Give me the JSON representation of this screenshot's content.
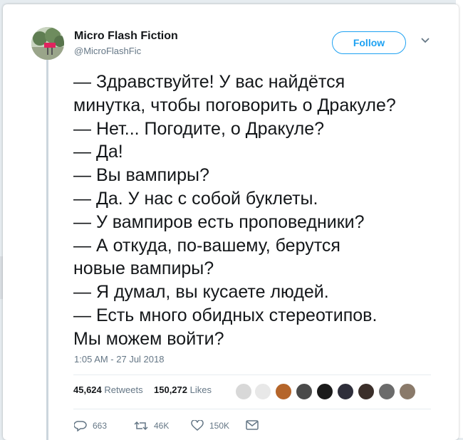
{
  "tweet": {
    "display_name": "Micro Flash Fiction",
    "screen_name": "@MicroFlashFic",
    "follow_label": "Follow",
    "lines": [
      "— Здравствуйте! У вас найдётся",
      "минутка, чтобы поговорить о Дракуле?",
      "— Нет... Погодите, о Дракуле?",
      "— Да!",
      "— Вы вампиры?",
      "— Да. У нас с собой буклеты.",
      "— У вампиров есть проповедники?",
      "— А откуда, по-вашему, берутся",
      "новые вампиры?",
      "— Я думал, вы кусаете людей.",
      "— Есть много обидных стереотипов.",
      "Мы можем войти?"
    ],
    "timestamp": "1:05 AM - 27 Jul 2018"
  },
  "stats": {
    "retweets_count": "45,624",
    "retweets_label": "Retweets",
    "likes_count": "150,272",
    "likes_label": "Likes"
  },
  "actions": {
    "replies": "663",
    "retweets": "46K",
    "likes": "150K"
  },
  "colors": {
    "accent": "#1da1f2",
    "text": "#14171a",
    "muted": "#657786"
  }
}
